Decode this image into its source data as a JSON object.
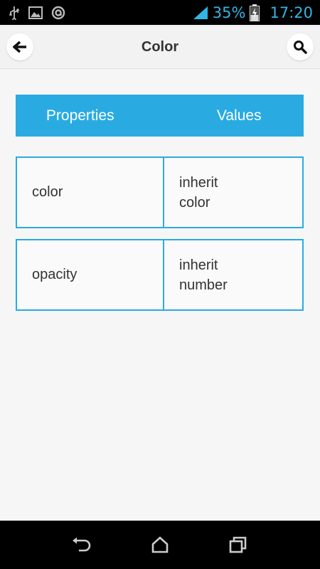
{
  "status": {
    "battery": "35%",
    "time": "17:20",
    "accent": "#33b5e5",
    "icons": [
      "usb-icon",
      "image-icon",
      "sync-icon",
      "signal-icon",
      "battery-charging-icon"
    ]
  },
  "appbar": {
    "title": "Color",
    "back_icon": "back-arrow-icon",
    "search_icon": "search-icon"
  },
  "table": {
    "headers": [
      "Properties",
      "Values"
    ],
    "header_color": "#29abe2",
    "rows": [
      {
        "property": "color",
        "values": [
          "inherit",
          "color"
        ]
      },
      {
        "property": "opacity",
        "values": [
          "inherit",
          "number"
        ]
      }
    ]
  },
  "navbar": {
    "icons": [
      "nav-back-icon",
      "nav-home-icon",
      "nav-recents-icon"
    ]
  }
}
